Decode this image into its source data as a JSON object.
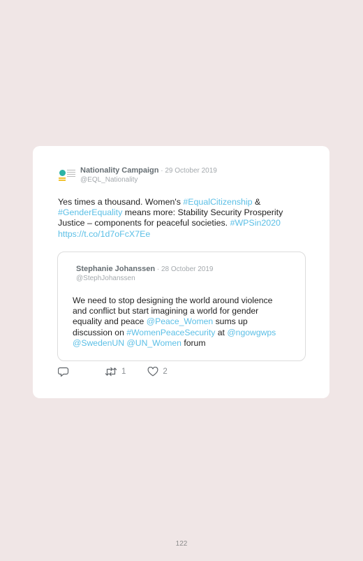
{
  "tweet": {
    "author_name": "Nationality Campaign",
    "separator": " · ",
    "date": "29 October 2019",
    "handle": "@EQL_Nationality",
    "text_parts": [
      {
        "t": "Yes times a thousand. Women's ",
        "link": false
      },
      {
        "t": "#EqualCitizenship",
        "link": true
      },
      {
        "t": " & ",
        "link": false
      },
      {
        "t": "#GenderEquality",
        "link": true
      },
      {
        "t": " means more: Stability Security Prosperity Justice – components for peaceful societies. ",
        "link": false
      },
      {
        "t": "#WPSin2020",
        "link": true
      },
      {
        "t": " ",
        "link": false
      },
      {
        "t": "https://t.co/1d7oFcX7Ee",
        "link": true
      }
    ]
  },
  "quoted_tweet": {
    "author_name": "Stephanie Johanssen",
    "separator": " · ",
    "date": "28 October 2019",
    "handle": "@StephJohanssen",
    "text_parts": [
      {
        "t": "We need to stop designing the world around violence and conflict but start imagining a world for gender equality and peace ",
        "link": false
      },
      {
        "t": "@Peace_Women",
        "link": true
      },
      {
        "t": " sums up discussion on ",
        "link": false
      },
      {
        "t": "#WomenPeaceSecurity",
        "link": true
      },
      {
        "t": " at ",
        "link": false
      },
      {
        "t": "@ngowgwps",
        "link": true
      },
      {
        "t": " ",
        "link": false
      },
      {
        "t": "@SwedenUN",
        "link": true
      },
      {
        "t": " ",
        "link": false
      },
      {
        "t": "@UN_Women",
        "link": true
      },
      {
        "t": " forum",
        "link": false
      }
    ]
  },
  "actions": {
    "reply_icon": "reply-icon",
    "retweet_icon": "retweet-icon",
    "retweet_count": "1",
    "like_icon": "heart-icon",
    "like_count": "2"
  },
  "colors": {
    "page_bg": "#f0e6e6",
    "link": "#5bbfe6",
    "muted": "#a4a9ad"
  },
  "page_number": "122"
}
